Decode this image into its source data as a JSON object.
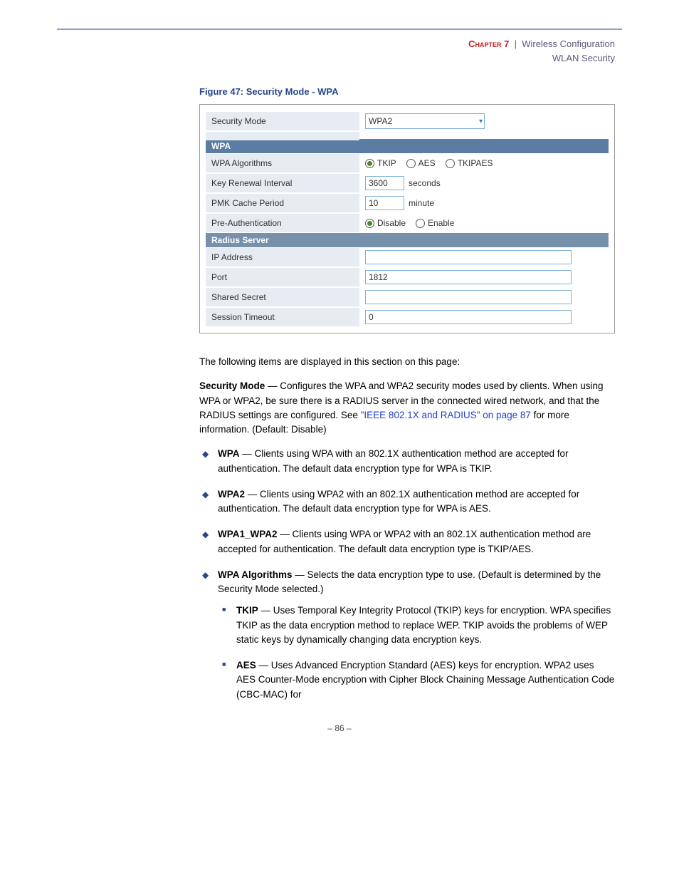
{
  "header": {
    "chapter": "Chapter 7",
    "pipe": "|",
    "title": "Wireless Configuration",
    "subtitle": "WLAN Security"
  },
  "figure": {
    "caption": "Figure 47:  Security Mode - WPA"
  },
  "screenshot": {
    "securityMode": {
      "label": "Security Mode",
      "value": "WPA2"
    },
    "sectionWpa": "WPA",
    "wpaAlg": {
      "label": "WPA Algorithms",
      "opts": {
        "tkip": "TKIP",
        "aes": "AES",
        "tkipaes": "TKIPAES"
      }
    },
    "keyRenew": {
      "label": "Key Renewal Interval",
      "value": "3600",
      "unit": "seconds"
    },
    "pmk": {
      "label": "PMK Cache Period",
      "value": "10",
      "unit": "minute"
    },
    "preAuth": {
      "label": "Pre-Authentication",
      "disable": "Disable",
      "enable": "Enable"
    },
    "sectionRadius": "Radius Server",
    "ip": {
      "label": "IP Address",
      "value": ""
    },
    "port": {
      "label": "Port",
      "value": "1812"
    },
    "secret": {
      "label": "Shared Secret",
      "value": ""
    },
    "timeout": {
      "label": "Session Timeout",
      "value": "0"
    }
  },
  "body": {
    "intro": "The following items are displayed in this section on this page:",
    "secModeLabel": "Security Mode",
    "secMode1": " — Configures the WPA and WPA2 security modes used by clients. When using WPA or WPA2, be sure there is a RADIUS server in the connected wired network, and that the RADIUS settings are configured. See ",
    "secModeLink": "\"IEEE 802.1X and RADIUS\" on page 87",
    "secMode2": " for more information. (Default: Disable)",
    "wpa": {
      "t": "WPA",
      "d": " — Clients using WPA with an 802.1X authentication method are accepted for authentication. The default data encryption type for WPA is TKIP."
    },
    "wpa2": {
      "t": "WPA2",
      "d": " — Clients using WPA2 with an 802.1X authentication method are accepted for authentication. The default data encryption type for WPA is AES."
    },
    "wpa12": {
      "t": "WPA1_WPA2",
      "d": " — Clients using WPA or WPA2 with an 802.1X authentication method are accepted for authentication. The default data encryption type is TKIP/AES."
    },
    "alg": {
      "t": "WPA Algorithms",
      "d": " — Selects the data encryption type to use. (Default is determined by the Security Mode selected.)"
    },
    "tkip": {
      "t": "TKIP",
      "d": " — Uses Temporal Key Integrity Protocol (TKIP) keys for encryption. WPA specifies TKIP as the data encryption method to replace WEP. TKIP avoids the problems of WEP static keys by dynamically changing data encryption keys."
    },
    "aes": {
      "t": "AES",
      "d": " — Uses Advanced Encryption Standard (AES) keys for encryption. WPA2 uses AES Counter-Mode encryption with Cipher Block Chaining Message Authentication Code (CBC-MAC) for"
    }
  },
  "pageNum": "–  86  –"
}
